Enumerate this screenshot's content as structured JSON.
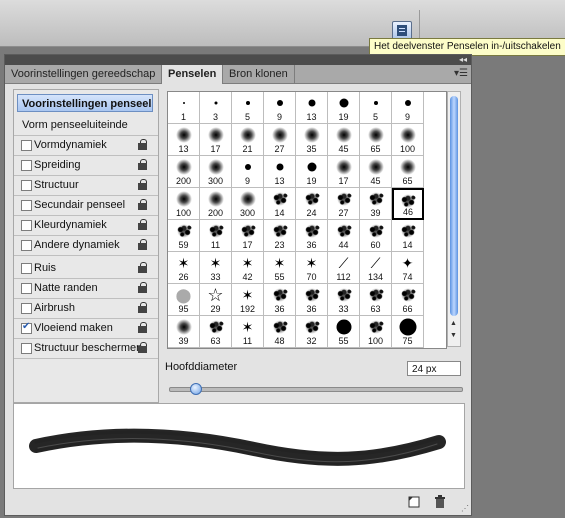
{
  "tooltip": {
    "text": "Het deelvenster Penselen in-/uitschakelen"
  },
  "tabs": [
    {
      "label": "Voorinstellingen gereedschap",
      "active": false
    },
    {
      "label": "Penselen",
      "active": true
    },
    {
      "label": "Bron klonen",
      "active": false
    }
  ],
  "left": {
    "preset_button": "Voorinstellingen penseel",
    "tip_shape": "Vorm penseeluiteinde",
    "options": [
      {
        "label": "Vormdynamiek",
        "checked": false,
        "lock": true
      },
      {
        "label": "Spreiding",
        "checked": false,
        "lock": true
      },
      {
        "label": "Structuur",
        "checked": false,
        "lock": true
      },
      {
        "label": "Secundair penseel",
        "checked": false,
        "lock": true
      },
      {
        "label": "Kleurdynamiek",
        "checked": false,
        "lock": true
      },
      {
        "label": "Andere dynamiek",
        "checked": false,
        "lock": true
      },
      {
        "label": "Ruis",
        "checked": false,
        "lock": true
      },
      {
        "label": "Natte randen",
        "checked": false,
        "lock": true
      },
      {
        "label": "Airbrush",
        "checked": false,
        "lock": true
      },
      {
        "label": "Vloeiend maken",
        "checked": true,
        "lock": true
      },
      {
        "label": "Structuur beschermen",
        "checked": false,
        "lock": true
      }
    ]
  },
  "brushes": {
    "selected_index": 31,
    "items": [
      {
        "size": "1",
        "style": "hard"
      },
      {
        "size": "3",
        "style": "hard"
      },
      {
        "size": "5",
        "style": "hard"
      },
      {
        "size": "9",
        "style": "hard"
      },
      {
        "size": "13",
        "style": "hard"
      },
      {
        "size": "19",
        "style": "hard"
      },
      {
        "size": "5",
        "style": "hard"
      },
      {
        "size": "9",
        "style": "hard"
      },
      {
        "size": "13",
        "style": "soft"
      },
      {
        "size": "17",
        "style": "soft"
      },
      {
        "size": "21",
        "style": "soft"
      },
      {
        "size": "27",
        "style": "soft"
      },
      {
        "size": "35",
        "style": "soft"
      },
      {
        "size": "45",
        "style": "soft"
      },
      {
        "size": "65",
        "style": "soft"
      },
      {
        "size": "100",
        "style": "soft"
      },
      {
        "size": "200",
        "style": "soft"
      },
      {
        "size": "300",
        "style": "soft"
      },
      {
        "size": "9",
        "style": "hard"
      },
      {
        "size": "13",
        "style": "hard"
      },
      {
        "size": "19",
        "style": "hard"
      },
      {
        "size": "17",
        "style": "soft"
      },
      {
        "size": "45",
        "style": "soft"
      },
      {
        "size": "65",
        "style": "soft"
      },
      {
        "size": "100",
        "style": "soft"
      },
      {
        "size": "200",
        "style": "soft"
      },
      {
        "size": "300",
        "style": "soft"
      },
      {
        "size": "14",
        "style": "splatter"
      },
      {
        "size": "24",
        "style": "splatter"
      },
      {
        "size": "27",
        "style": "splatter"
      },
      {
        "size": "39",
        "style": "splatter"
      },
      {
        "size": "46",
        "style": "splatter"
      },
      {
        "size": "59",
        "style": "splatter"
      },
      {
        "size": "11",
        "style": "splatter"
      },
      {
        "size": "17",
        "style": "splatter"
      },
      {
        "size": "23",
        "style": "splatter"
      },
      {
        "size": "36",
        "style": "splatter"
      },
      {
        "size": "44",
        "style": "splatter"
      },
      {
        "size": "60",
        "style": "splatter"
      },
      {
        "size": "14",
        "style": "splatter"
      },
      {
        "size": "26",
        "style": "star"
      },
      {
        "size": "33",
        "style": "star"
      },
      {
        "size": "42",
        "style": "star"
      },
      {
        "size": "55",
        "style": "star"
      },
      {
        "size": "70",
        "style": "star"
      },
      {
        "size": "112",
        "style": "grass"
      },
      {
        "size": "134",
        "style": "grass"
      },
      {
        "size": "74",
        "style": "leaf"
      },
      {
        "size": "95",
        "style": "leaf"
      },
      {
        "size": "29",
        "style": "outline-star"
      },
      {
        "size": "192",
        "style": "star"
      },
      {
        "size": "36",
        "style": "splatter"
      },
      {
        "size": "36",
        "style": "splatter"
      },
      {
        "size": "33",
        "style": "splatter"
      },
      {
        "size": "63",
        "style": "splatter"
      },
      {
        "size": "66",
        "style": "splatter"
      },
      {
        "size": "39",
        "style": "soft"
      },
      {
        "size": "63",
        "style": "splatter"
      },
      {
        "size": "11",
        "style": "star"
      },
      {
        "size": "48",
        "style": "splatter"
      },
      {
        "size": "32",
        "style": "splatter"
      },
      {
        "size": "55",
        "style": "hard"
      },
      {
        "size": "100",
        "style": "splatter"
      },
      {
        "size": "75",
        "style": "hard"
      }
    ]
  },
  "diameter": {
    "label": "Hoofddiameter",
    "value": "24 px",
    "slider_fraction": 0.09
  }
}
